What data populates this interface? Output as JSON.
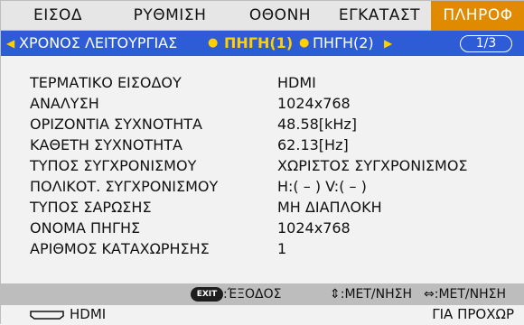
{
  "tabs": {
    "items": [
      {
        "label": "ΕΙΣΟΔ"
      },
      {
        "label": "ΡΥΘΜΙΣΗ"
      },
      {
        "label": "ΟΘΟΝΗ"
      },
      {
        "label": "ΕΓΚΑΤΑΣΤ"
      },
      {
        "label": "ΠΛΗΡΟΦ",
        "active": true
      }
    ],
    "active_color": "#e08a00"
  },
  "subtabs": {
    "items": [
      {
        "label": "ΧΡΟΝΟΣ ΛΕΙΤΟΥΡΓΙΑΣ"
      },
      {
        "label": "ΠΗΓΗ(1)",
        "active": true
      },
      {
        "label": "ΠΗΓΗ(2)"
      }
    ],
    "left_arrow": "◀",
    "right_arrow": "▶",
    "separator": "●",
    "page": "1/3",
    "bar_color": "#2e5bd6",
    "active_color": "#ffd000"
  },
  "info": [
    {
      "label": "ΤΕΡΜΑΤΙΚΟ ΕΙΣΟΔΟΥ",
      "value": "HDMI"
    },
    {
      "label": "ΑΝΑΛΥΣΗ",
      "value": "1024x768"
    },
    {
      "label": "ΟΡΙΖΟΝΤΙΑ ΣΥΧΝΟΤΗΤΑ",
      "value": "48.58[kHz]"
    },
    {
      "label": "ΚΑΘΕΤΗ ΣΥΧΝΟΤΗΤΑ",
      "value": "62.13[Hz]"
    },
    {
      "label": "ΤΥΠΟΣ ΣΥΓΧΡΟΝΙΣΜΟΥ",
      "value": "ΧΩΡΙΣΤΟΣ ΣΥΓΧΡΟΝΙΣΜΟΣ"
    },
    {
      "label": "ΠΟΛΙΚΟΤ. ΣΥΓΧΡΟΝΙΣΜΟΥ",
      "value": "H:( – ) V:( – )"
    },
    {
      "label": "ΤΥΠΟΣ ΣΑΡΩΣΗΣ",
      "value": "ΜΗ ΔΙΑΠΛΟΚΗ"
    },
    {
      "label": "ΟΝΟΜΑ ΠΗΓΗΣ",
      "value": "1024x768"
    },
    {
      "label": "ΑΡΙΘΜΟΣ ΚΑΤΑΧΩΡΗΣΗΣ",
      "value": "1"
    }
  ],
  "help": {
    "exit_key": "EXIT",
    "exit_text": ":ΈΞΟΔΟΣ",
    "updown_text": "⇕:ΜΕΤ/ΝΗΣΗ",
    "leftright_text": "⇔:ΜΕΤ/ΝΗΣΗ"
  },
  "status": {
    "source_icon": "hdmi-connector-icon",
    "source": "HDMI",
    "mode": "ΓΙΑ ΠΡΟΧΩΡ"
  }
}
